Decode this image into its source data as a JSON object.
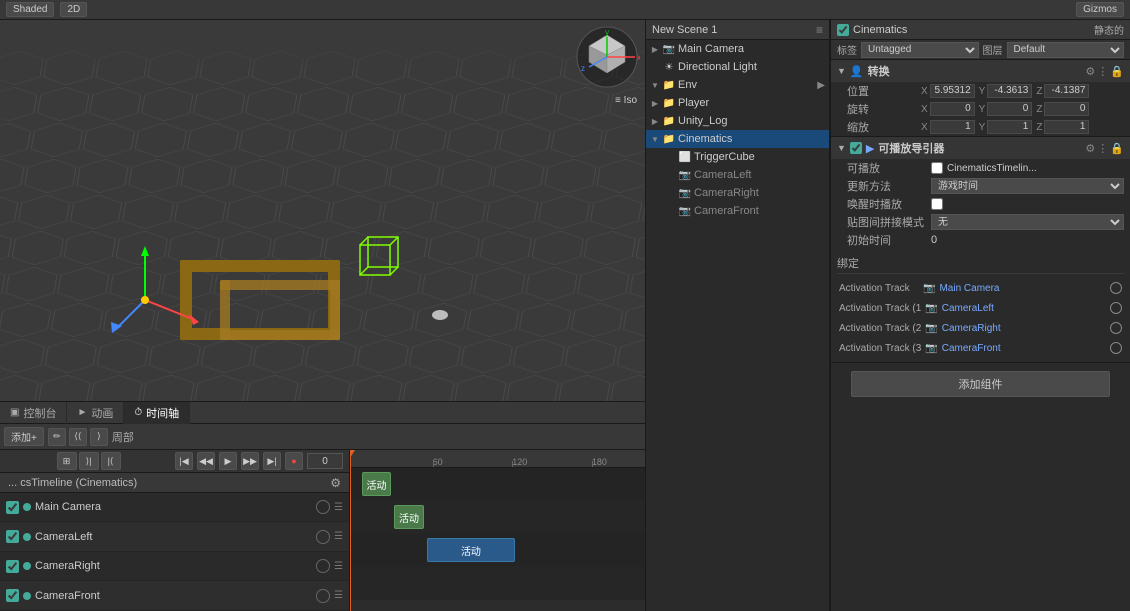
{
  "topbar": {
    "shading_label": "Shaded",
    "mode_label": "2D",
    "stats_label": "Gizmos",
    "iso_label": "≡ Iso"
  },
  "hierarchy": {
    "title": "New Scene 1",
    "menu_icon": "≡",
    "items": [
      {
        "id": "main-camera",
        "label": "Main Camera",
        "indent": 0,
        "icon": "📷",
        "expanded": false,
        "selected": false
      },
      {
        "id": "directional-light",
        "label": "Directional Light",
        "indent": 0,
        "icon": "💡",
        "expanded": false,
        "selected": false
      },
      {
        "id": "env",
        "label": "Env",
        "indent": 0,
        "icon": "📁",
        "expanded": true,
        "selected": false
      },
      {
        "id": "player",
        "label": "Player",
        "indent": 0,
        "icon": "📁",
        "expanded": false,
        "selected": false
      },
      {
        "id": "unity-log",
        "label": "Unity_Log",
        "indent": 0,
        "icon": "📁",
        "expanded": false,
        "selected": false
      },
      {
        "id": "cinematics",
        "label": "Cinematics",
        "indent": 0,
        "icon": "📁",
        "expanded": true,
        "selected": true
      },
      {
        "id": "trigger-cube",
        "label": "TriggerCube",
        "indent": 1,
        "icon": "⬜",
        "expanded": false,
        "selected": false
      },
      {
        "id": "camera-left",
        "label": "CameraLeft",
        "indent": 1,
        "icon": "📷",
        "expanded": false,
        "selected": false,
        "gray": true
      },
      {
        "id": "camera-right",
        "label": "CameraRight",
        "indent": 1,
        "icon": "📷",
        "expanded": false,
        "selected": false,
        "gray": true
      },
      {
        "id": "camera-front",
        "label": "CameraFront",
        "indent": 1,
        "icon": "📷",
        "expanded": false,
        "selected": false,
        "gray": true
      }
    ]
  },
  "inspector": {
    "title": "Cinematics",
    "static_label": "静态的",
    "tag_label": "标签",
    "tag_value": "Untagged",
    "layer_label": "图层",
    "layer_value": "Default",
    "transform": {
      "title": "转换",
      "position_label": "位置",
      "rotation_label": "旋转",
      "scale_label": "缩放",
      "pos_x": "X",
      "pos_x_val": "5.95312",
      "pos_y": "Y",
      "pos_y_val": "-4.3613",
      "pos_z": "Z",
      "pos_z_val": "-4.1387",
      "rot_x": "X",
      "rot_x_val": "0",
      "rot_y": "Y",
      "rot_y_val": "0",
      "rot_z": "Z",
      "rot_z_val": "0",
      "scl_x": "X",
      "scl_x_val": "1",
      "scl_y": "Y",
      "scl_y_val": "1",
      "scl_z": "Z",
      "scl_z_val": "1"
    },
    "playable_director": {
      "title": "可播放导引器",
      "checkbox_label": "✓",
      "script_label": "CinematicsTimelin...",
      "playback_label": "可播放",
      "update_method_label": "更新方法",
      "update_method_val": "游戏时间",
      "on_awake_label": "唤醒时播放",
      "wrap_mode_label": "贴图间拼接模式",
      "wrap_mode_val": "无",
      "init_time_label": "初始时间",
      "init_time_val": "0",
      "bindings_label": "绑定",
      "bindings": [
        {
          "track": "Activation Track",
          "camera": "Main Camera"
        },
        {
          "track": "Activation Track (1",
          "camera": "CameraLeft"
        },
        {
          "track": "Activation Track (2",
          "camera": "CameraRight"
        },
        {
          "track": "Activation Track (3",
          "camera": "CameraFront"
        }
      ]
    },
    "add_component_label": "添加组件"
  },
  "timeline": {
    "tabs": [
      {
        "id": "console",
        "label": "控制台",
        "icon": "▣",
        "active": false
      },
      {
        "id": "animation",
        "label": "动画",
        "icon": "►",
        "active": false
      },
      {
        "id": "timeline",
        "label": "时间轴",
        "icon": "⏱",
        "active": true
      }
    ],
    "title": "... csTimeline (Cinematics)",
    "add_label": "添加+",
    "frame_value": "0",
    "panel_label": "周部",
    "tracks": [
      {
        "id": "main-camera-track",
        "name": "Main Camera",
        "color": "#4a9"
      },
      {
        "id": "camera-left-track",
        "name": "CameraLeft",
        "color": "#4a9"
      },
      {
        "id": "camera-right-track",
        "name": "CameraRight",
        "color": "#4a9"
      },
      {
        "id": "camera-front-track",
        "name": "CameraFront",
        "color": "#4a9"
      }
    ],
    "clips": [
      {
        "track": 0,
        "start_pct": 4,
        "width_pct": 11,
        "label": "活动",
        "color": "green"
      },
      {
        "track": 1,
        "start_pct": 15,
        "width_pct": 11,
        "label": "活动",
        "color": "green"
      },
      {
        "track": 2,
        "start_pct": 26,
        "width_pct": 30,
        "label": "活动",
        "color": "blue"
      }
    ],
    "ruler_marks": [
      "60",
      "120",
      "180"
    ],
    "ruler_positions": [
      28,
      55,
      82
    ]
  }
}
